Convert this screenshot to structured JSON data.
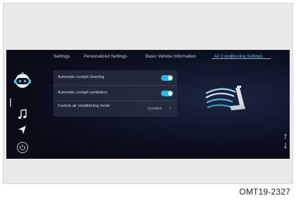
{
  "tabs": [
    {
      "label": "Settings",
      "active": false
    },
    {
      "label": "Personalized Settings",
      "active": false
    },
    {
      "label": "Basic Vehicle Information",
      "active": false
    },
    {
      "label": "Air Conditioning Settings",
      "active": true
    }
  ],
  "settings_rows": [
    {
      "label": "Automatic cockpit cleaning",
      "control": "toggle",
      "on": true
    },
    {
      "label": "Automatic cockpit ventilation",
      "control": "toggle",
      "on": true
    },
    {
      "label": "Custom air conditioning mode",
      "control": "select",
      "value": "Comfort"
    }
  ],
  "sidebar": {
    "icons": [
      "robot-assistant-icon",
      "music-note-icon",
      "navigation-arrow-icon",
      "power-icon"
    ]
  },
  "colors": {
    "accent": "#43c8ee",
    "toggle_on": "#2fb7e0",
    "screen_bg": "#0b0f1f"
  },
  "caption": "OMT19-2327"
}
